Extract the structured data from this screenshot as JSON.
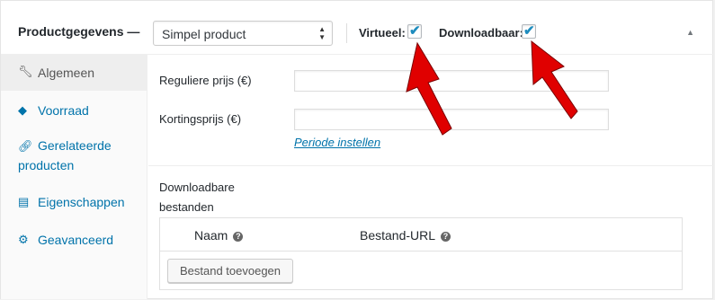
{
  "header": {
    "title": "Productgegevens —",
    "product_type": "Simpel product",
    "virtual_label": "Virtueel:",
    "downloadable_label": "Downloadbaar:",
    "virtual_checked": true,
    "downloadable_checked": true
  },
  "tabs": [
    {
      "label": "Algemeen",
      "icon": "wrench-icon",
      "active": true
    },
    {
      "label": "Voorraad",
      "icon": "tag-icon"
    },
    {
      "label": "Gerelateerde producten",
      "line1": "Gerelateerde",
      "line2": "producten",
      "icon": "link-icon"
    },
    {
      "label": "Eigenschappen",
      "icon": "table-icon"
    },
    {
      "label": "Geavanceerd",
      "icon": "gear-icon"
    }
  ],
  "general": {
    "regular_price_label": "Reguliere prijs (€)",
    "regular_price_value": "",
    "sale_price_label": "Kortingsprijs (€)",
    "sale_price_value": "",
    "schedule_link": "Periode instellen"
  },
  "downloads": {
    "label_line1": "Downloadbare",
    "label_line2": "bestanden",
    "col_name": "Naam",
    "col_url": "Bestand-URL",
    "add_button": "Bestand toevoegen"
  },
  "colors": {
    "link": "#0073aa",
    "checkmark": "#1e8cbe",
    "annotation_arrow": "#e00000"
  }
}
